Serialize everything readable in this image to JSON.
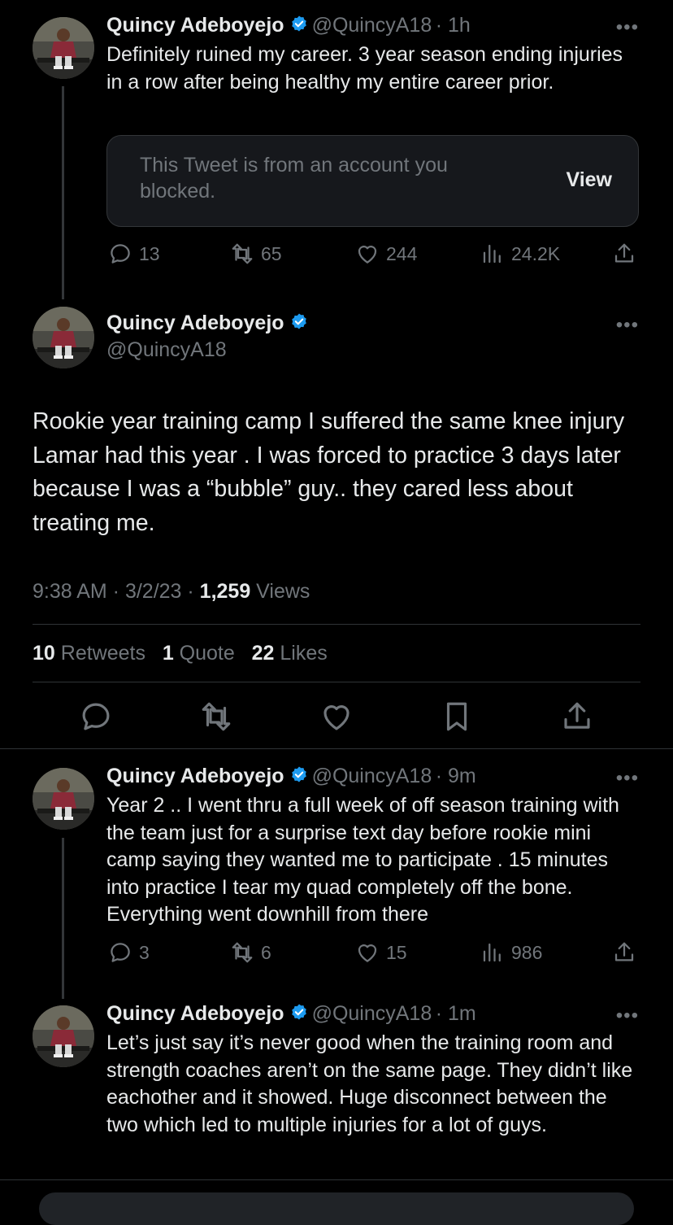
{
  "colors": {
    "background": "#000000",
    "text": "#e7e9ea",
    "muted": "#71767b",
    "verified": "#1d9bf0",
    "border": "#2f3336"
  },
  "tweet1": {
    "name": "Quincy Adeboyejo",
    "handle": "@QuincyA18",
    "time": "· 1h",
    "text": "Definitely ruined my career. 3 year season ending injuries in a row after being healthy my entire career prior.",
    "quoted": {
      "text": "This Tweet is from an account you blocked.",
      "view_label": "View"
    },
    "replies": "13",
    "retweets": "65",
    "likes": "244",
    "views": "24.2K"
  },
  "main": {
    "name": "Quincy Adeboyejo",
    "handle": "@QuincyA18",
    "text": "Rookie year training camp I suffered the same knee injury Lamar had this year . I was forced to practice 3 days later because I was a “bubble” guy.. they cared less about treating me.",
    "time": "9:38 AM · 3/2/23 · ",
    "views_count": "1,259",
    "views_label": " Views",
    "stats": {
      "retweets_count": "10",
      "retweets_label": " Retweets",
      "quotes_count": "1",
      "quotes_label": " Quote",
      "likes_count": "22",
      "likes_label": " Likes"
    }
  },
  "tweet3": {
    "name": "Quincy Adeboyejo",
    "handle": "@QuincyA18",
    "time": "· 9m",
    "text": "Year 2 .. I went thru a full week of off season training with the team just for a surprise text day before rookie mini camp saying they wanted me to participate . 15 minutes into practice I tear my quad completely off the bone. Everything went downhill from there",
    "replies": "3",
    "retweets": "6",
    "likes": "15",
    "views": "986"
  },
  "tweet4": {
    "name": "Quincy Adeboyejo",
    "handle": "@QuincyA18",
    "time": "· 1m",
    "text": "Let’s just say it’s never good when the training room and strength coaches aren’t on the same page. They didn’t like eachother and it showed. Huge disconnect between the two which led to multiple injuries for a lot of guys."
  },
  "more_label": "•••"
}
